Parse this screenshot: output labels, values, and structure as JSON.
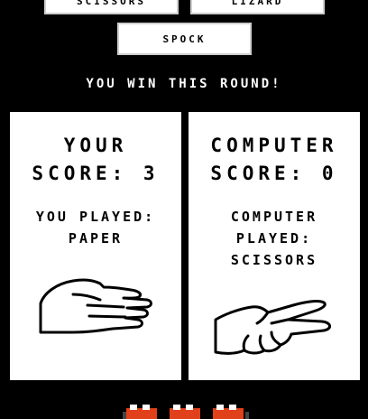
{
  "buttons": {
    "scissors": "Scissors",
    "lizard": "Lizard",
    "spock": "Spock"
  },
  "result": "YOU WIN THIS ROUND!",
  "player": {
    "score_label": "YOUR",
    "score_line2": "SCORE: 3",
    "played_line1": "YOU PLAYED:",
    "played_line2": "PAPER",
    "hand_icon": "paper-hand-icon"
  },
  "computer": {
    "score_label": "COMPUTER",
    "score_line2": "SCORE: 0",
    "played_line1": "COMPUTER",
    "played_line2": "PLAYED:",
    "played_line3": "SCISSORS",
    "hand_icon": "scissors-hand-icon"
  },
  "colors": {
    "background": "#000000",
    "panel": "#ffffff",
    "accent": "#e0401a"
  }
}
